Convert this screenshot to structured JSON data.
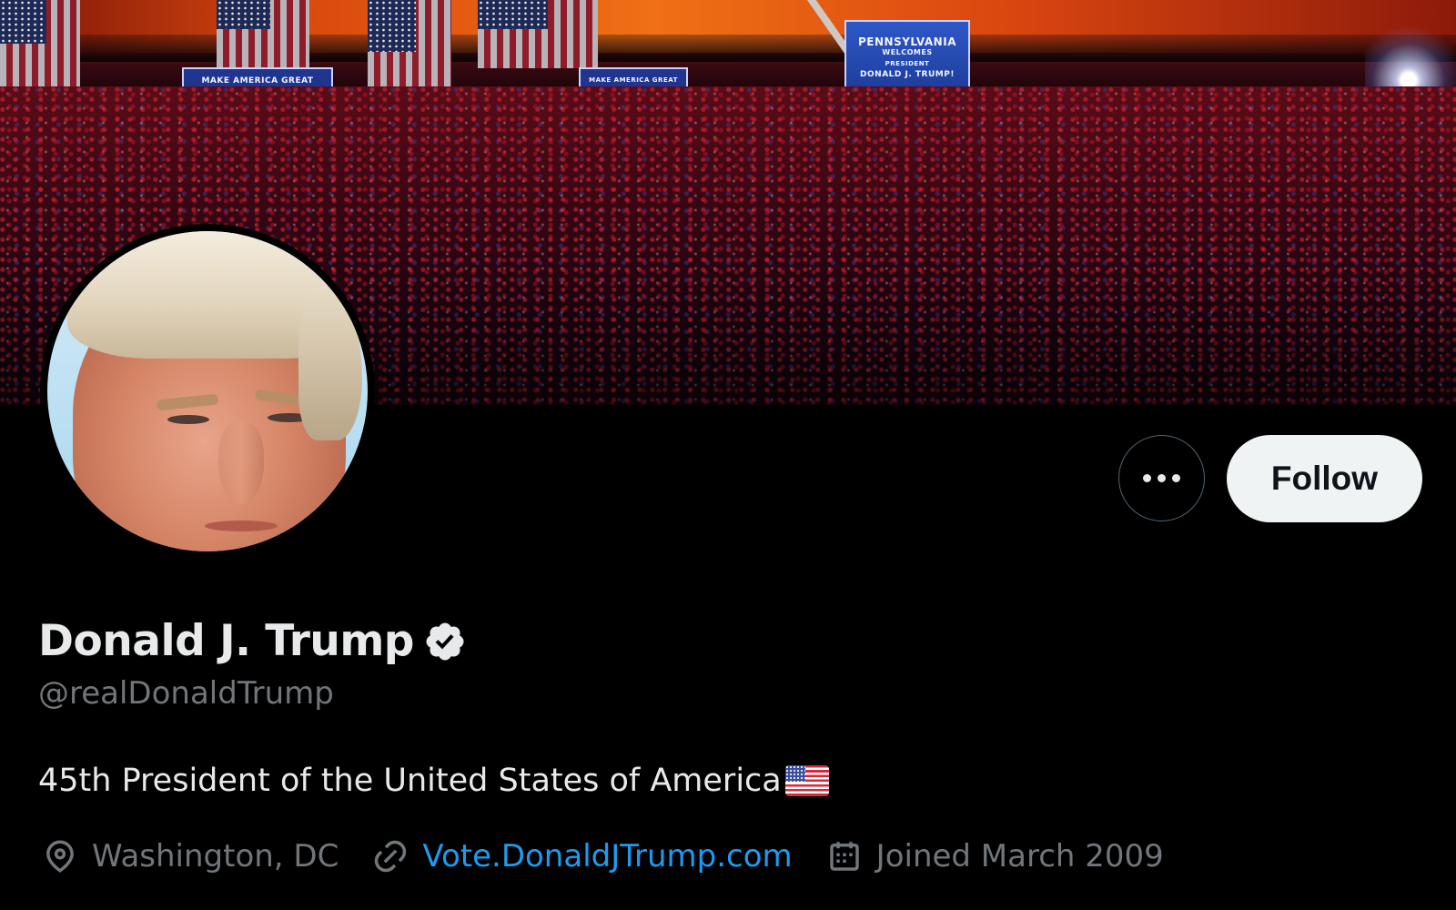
{
  "banner": {
    "sign_left": "MAKE AMERICA GREAT AGAIN!",
    "sign_middle": "MAKE AMERICA GREAT AGAIN!",
    "sign_screen_lines": [
      "PENNSYLVANIA",
      "WELCOMES",
      "PRESIDENT",
      "DONALD J. TRUMP!"
    ]
  },
  "profile": {
    "display_name": "Donald J. Trump",
    "handle": "@realDonaldTrump",
    "bio": "45th President of the United States of America",
    "bio_emoji_icon": "us-flag-icon",
    "location": "Washington, DC",
    "website": "Vote.DonaldJTrump.com",
    "joined": "Joined March 2009",
    "verified": true
  },
  "actions": {
    "more_icon": "more-horizontal-icon",
    "follow_label": "Follow"
  },
  "colors": {
    "background": "#000000",
    "primary_text": "#e7e9ea",
    "secondary_text": "#71767b",
    "link": "#1d9bf0",
    "follow_button_bg": "#eff3f4",
    "follow_button_text": "#0f1419",
    "border": "#536471",
    "verified_badge": "#e7e9ea"
  }
}
